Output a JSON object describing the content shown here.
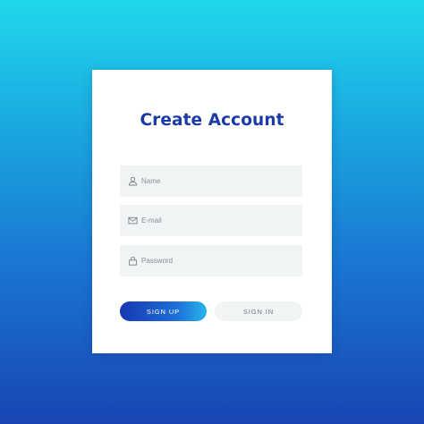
{
  "form": {
    "title": "Create Account",
    "fields": [
      {
        "placeholder": "Name",
        "icon": "user-icon"
      },
      {
        "placeholder": "E-mail",
        "icon": "mail-icon"
      },
      {
        "placeholder": "Password",
        "icon": "lock-icon"
      }
    ],
    "sign_up_label": "SIGN UP",
    "sign_in_label": "SIGN IN"
  },
  "colors": {
    "accent": "#1a3aa8",
    "background_top": "#21d8ea",
    "background_bottom": "#1845b3",
    "field_background": "#f1f4f5"
  }
}
